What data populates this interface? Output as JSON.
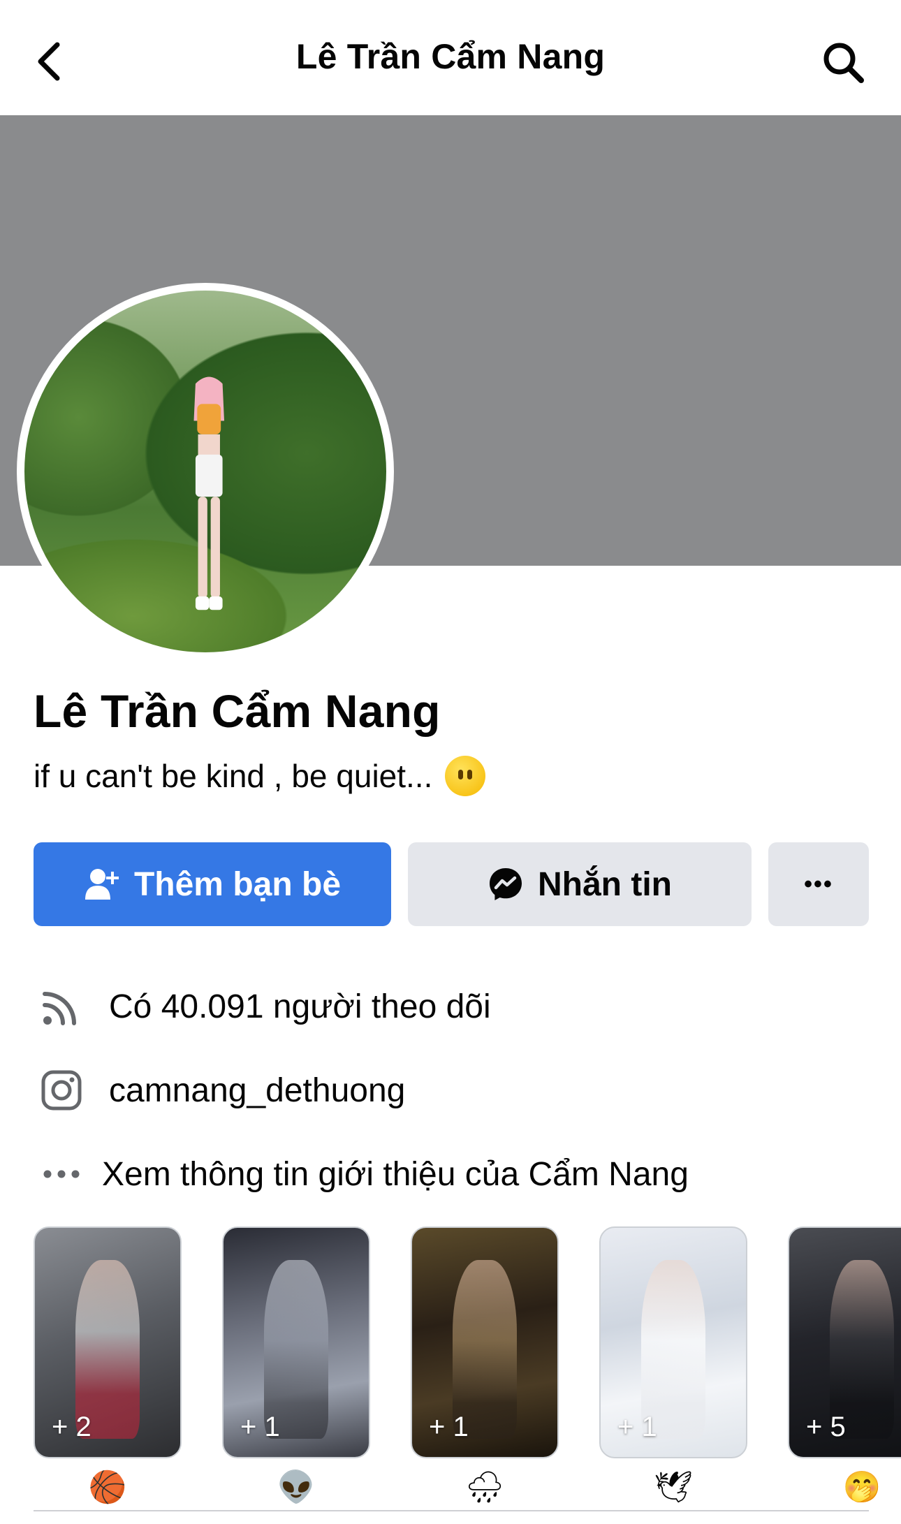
{
  "header": {
    "title": "Lê Trần Cẩm Nang"
  },
  "profile": {
    "name": "Lê Trần Cẩm Nang",
    "bio": "if u can't be kind , be quiet..."
  },
  "actions": {
    "add_friend_label": "Thêm bạn bè",
    "message_label": "Nhắn tin",
    "more_label": "•••"
  },
  "info": {
    "followers": "Có 40.091 người theo dõi",
    "instagram": "camnang_dethuong",
    "about": "Xem thông tin giới thiệu của Cẩm Nang"
  },
  "featured": {
    "stories": [
      {
        "count": "+ 2",
        "icon": "🏀"
      },
      {
        "count": "+ 1",
        "icon": "👽"
      },
      {
        "count": "+ 1",
        "icon": "🌧"
      },
      {
        "count": "+ 1",
        "icon": "🕊"
      },
      {
        "count": "+ 5",
        "icon": "🤭"
      }
    ]
  },
  "colors": {
    "primary": "#3578e5",
    "secondary_button": "#e4e6eb",
    "cover": "#8a8b8d",
    "text": "#050505"
  }
}
